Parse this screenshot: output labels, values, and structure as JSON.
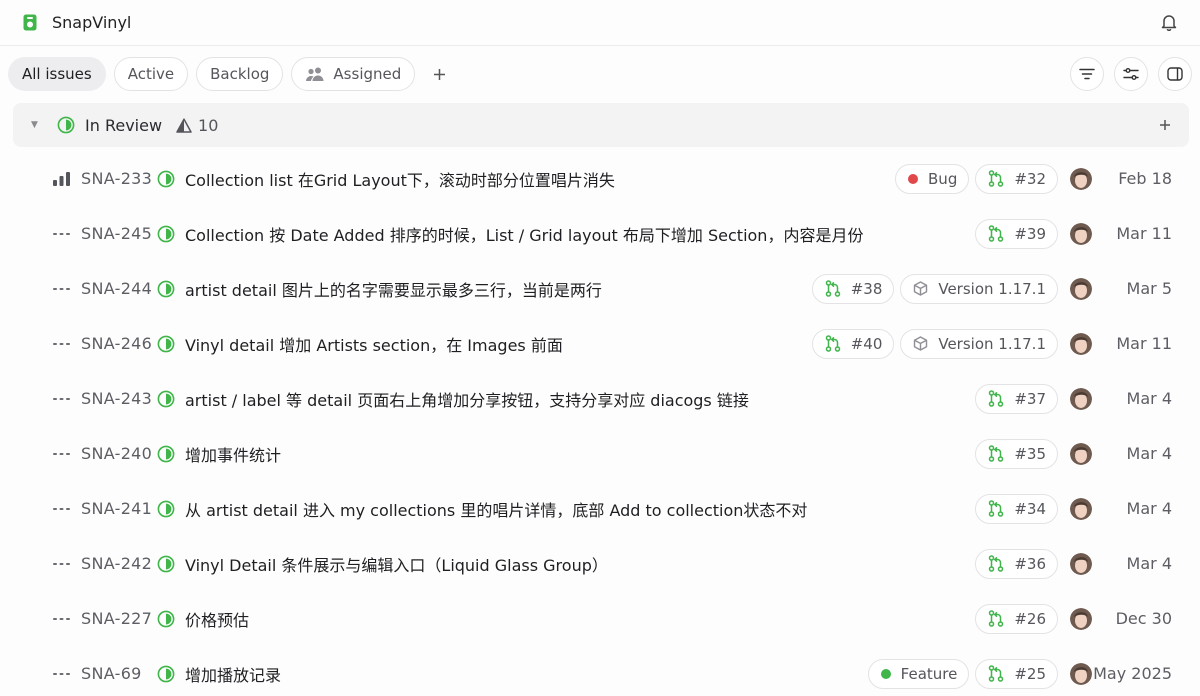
{
  "app": {
    "title": "SnapVinyl",
    "accent": "#3fb54a"
  },
  "tabs": [
    {
      "label": "All issues",
      "active": true
    },
    {
      "label": "Active",
      "active": false
    },
    {
      "label": "Backlog",
      "active": false
    },
    {
      "label": "Assigned",
      "active": false,
      "icon": "people-icon"
    }
  ],
  "group": {
    "label": "In Review",
    "count": "10"
  },
  "issues": [
    {
      "id": "SNA-233",
      "priority": "high",
      "title": "Collection list 在Grid Layout下，滚动时部分位置唱片消失",
      "label": "Bug",
      "label_color": "#e0484a",
      "pr": "#32",
      "date": "Feb 18"
    },
    {
      "id": "SNA-245",
      "priority": "none",
      "title": "Collection 按 Date Added 排序的时候，List / Grid layout 布局下增加 Section，内容是月份",
      "pr": "#39",
      "date": "Mar 11"
    },
    {
      "id": "SNA-244",
      "priority": "none",
      "title": "artist detail 图片上的名字需要显示最多三行，当前是两行",
      "pr": "#38",
      "version": "Version 1.17.1",
      "date": "Mar 5"
    },
    {
      "id": "SNA-246",
      "priority": "none",
      "title": "Vinyl detail 增加 Artists section，在 Images 前面",
      "pr": "#40",
      "version": "Version 1.17.1",
      "date": "Mar 11"
    },
    {
      "id": "SNA-243",
      "priority": "none",
      "title": "artist / label 等 detail 页面右上角增加分享按钮，支持分享对应 diacogs 链接",
      "pr": "#37",
      "date": "Mar 4"
    },
    {
      "id": "SNA-240",
      "priority": "none",
      "title": "增加事件统计",
      "pr": "#35",
      "date": "Mar 4"
    },
    {
      "id": "SNA-241",
      "priority": "none",
      "title": "从 artist detail 进入 my collections 里的唱片详情，底部 Add to collection状态不对",
      "pr": "#34",
      "date": "Mar 4"
    },
    {
      "id": "SNA-242",
      "priority": "none",
      "title": "Vinyl Detail 条件展示与编辑入口（Liquid Glass Group）",
      "pr": "#36",
      "date": "Mar 4"
    },
    {
      "id": "SNA-227",
      "priority": "none",
      "title": "价格预估",
      "pr": "#26",
      "date": "Dec 30"
    },
    {
      "id": "SNA-69",
      "priority": "none",
      "title": "增加播放记录",
      "label": "Feature",
      "label_color": "#3fb54a",
      "pr": "#25",
      "date": "May 2025"
    }
  ]
}
